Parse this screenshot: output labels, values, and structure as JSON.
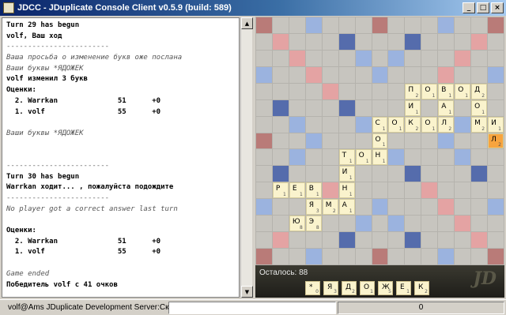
{
  "window": {
    "title": "JDCC - JDuplicate Console Client v0.5.9 (build: 589)",
    "minimize": "_",
    "maximize": "□",
    "close": "×"
  },
  "console": {
    "lines": [
      {
        "text": "Turn 29 has begun",
        "style": "b"
      },
      {
        "text": "volf, Ваш ход",
        "style": "b"
      },
      {
        "text": "------------------------",
        "style": "sep"
      },
      {
        "text": "Ваша просьба о изменение букв оже послана",
        "style": "i"
      },
      {
        "text": "Ваши буквы *ЯДОЖЕК",
        "style": "i"
      },
      {
        "text": "volf изменил 3 букв",
        "style": "b"
      },
      {
        "text": "Оценки:",
        "style": "b"
      },
      {
        "text": "  2. Warrkan              51      +0",
        "style": "b"
      },
      {
        "text": "  1. volf                 55      +0",
        "style": "b"
      },
      {
        "text": "",
        "style": ""
      },
      {
        "text": "Ваши буквы *ЯДОЖЕК",
        "style": "i"
      },
      {
        "text": "",
        "style": ""
      },
      {
        "text": "",
        "style": ""
      },
      {
        "text": "------------------------",
        "style": "sep"
      },
      {
        "text": "Turn 30 has begun",
        "style": "b"
      },
      {
        "text": "Warrkan ходит... , пожалуйста подождите",
        "style": "b"
      },
      {
        "text": "------------------------",
        "style": "sep"
      },
      {
        "text": "No player got a correct answer last turn",
        "style": "i"
      },
      {
        "text": "",
        "style": ""
      },
      {
        "text": "Оценки:",
        "style": "b"
      },
      {
        "text": "  2. Warrkan              51      +0",
        "style": "b"
      },
      {
        "text": "  1. volf                 55      +0",
        "style": "b"
      },
      {
        "text": "",
        "style": ""
      },
      {
        "text": "Game ended",
        "style": "i"
      },
      {
        "text": "Победитель volf с 41 очков",
        "style": "b"
      }
    ]
  },
  "board": {
    "tiles": [
      {
        "row": 4,
        "col": 9,
        "ch": "П",
        "pt": "2"
      },
      {
        "row": 4,
        "col": 10,
        "ch": "О",
        "pt": "1"
      },
      {
        "row": 4,
        "col": 11,
        "ch": "В",
        "pt": "1"
      },
      {
        "row": 4,
        "col": 12,
        "ch": "О",
        "pt": "1"
      },
      {
        "row": 4,
        "col": 13,
        "ch": "Д",
        "pt": "2"
      },
      {
        "row": 5,
        "col": 9,
        "ch": "И",
        "pt": "1"
      },
      {
        "row": 5,
        "col": 11,
        "ch": "А",
        "pt": "1"
      },
      {
        "row": 5,
        "col": 13,
        "ch": "О",
        "pt": "1"
      },
      {
        "row": 6,
        "col": 7,
        "ch": "С",
        "pt": "1"
      },
      {
        "row": 6,
        "col": 8,
        "ch": "О",
        "pt": "1"
      },
      {
        "row": 6,
        "col": 9,
        "ch": "К",
        "pt": "2"
      },
      {
        "row": 6,
        "col": 10,
        "ch": "О",
        "pt": "1"
      },
      {
        "row": 6,
        "col": 11,
        "ch": "Л",
        "pt": "2"
      },
      {
        "row": 6,
        "col": 13,
        "ch": "М",
        "pt": "2"
      },
      {
        "row": 6,
        "col": 14,
        "ch": "И",
        "pt": "1"
      },
      {
        "row": 7,
        "col": 7,
        "ch": "О",
        "pt": "1"
      },
      {
        "row": 7,
        "col": 14,
        "ch": "Л",
        "pt": "2",
        "last": true
      },
      {
        "row": 8,
        "col": 5,
        "ch": "Т",
        "pt": "1"
      },
      {
        "row": 8,
        "col": 6,
        "ch": "О",
        "pt": "1"
      },
      {
        "row": 8,
        "col": 7,
        "ch": "Н",
        "pt": "1"
      },
      {
        "row": 9,
        "col": 5,
        "ch": "И",
        "pt": "1"
      },
      {
        "row": 10,
        "col": 1,
        "ch": "Р",
        "pt": "1"
      },
      {
        "row": 10,
        "col": 2,
        "ch": "Е",
        "pt": "1"
      },
      {
        "row": 10,
        "col": 3,
        "ch": "В",
        "pt": "1"
      },
      {
        "row": 10,
        "col": 5,
        "ch": "Н",
        "pt": "1"
      },
      {
        "row": 11,
        "col": 3,
        "ch": "Я",
        "pt": "3"
      },
      {
        "row": 11,
        "col": 4,
        "ch": "М",
        "pt": "2"
      },
      {
        "row": 11,
        "col": 5,
        "ch": "А",
        "pt": "1"
      },
      {
        "row": 12,
        "col": 2,
        "ch": "Ю",
        "pt": "8"
      },
      {
        "row": 12,
        "col": 3,
        "ch": "Э",
        "pt": "8"
      }
    ]
  },
  "lower": {
    "remaining": "Осталось: 88",
    "rack": [
      {
        "ch": "*",
        "pt": "0"
      },
      {
        "ch": "Я",
        "pt": "3"
      },
      {
        "ch": "Д",
        "pt": "2"
      },
      {
        "ch": "О",
        "pt": "1"
      },
      {
        "ch": "Ж",
        "pt": "5"
      },
      {
        "ch": "Е",
        "pt": "1"
      },
      {
        "ch": "К",
        "pt": "2"
      }
    ],
    "logo": "JD"
  },
  "statusbar": {
    "text": "volf@Ams JDuplicate Development Server:Скрабл",
    "input": "",
    "progress": "0"
  }
}
